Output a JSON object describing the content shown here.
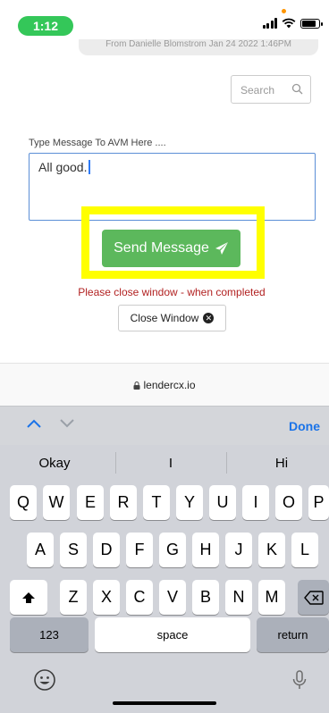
{
  "status": {
    "time": "1:12"
  },
  "chat": {
    "bubble_text": "From Danielle Blomstrom Jan 24 2022 1:46PM"
  },
  "search": {
    "placeholder": "Search"
  },
  "form": {
    "label": "Type Message To AVM Here ....",
    "message_value": "All good.",
    "send_label": "Send Message",
    "warning": "Please close window - when completed",
    "close_label": "Close Window"
  },
  "browser": {
    "url": "lendercx.io"
  },
  "accessory": {
    "done_label": "Done"
  },
  "keyboard": {
    "suggestions": [
      "Okay",
      "I",
      "Hi"
    ],
    "row1": [
      "Q",
      "W",
      "E",
      "R",
      "T",
      "Y",
      "U",
      "I",
      "O",
      "P"
    ],
    "row2": [
      "A",
      "S",
      "D",
      "F",
      "G",
      "H",
      "J",
      "K",
      "L"
    ],
    "row3": [
      "Z",
      "X",
      "C",
      "V",
      "B",
      "N",
      "M"
    ],
    "numbers_label": "123",
    "space_label": "space",
    "return_label": "return"
  },
  "colors": {
    "send_green": "#5cb85c",
    "highlight": "#ffff00",
    "warning_red": "#b22222",
    "link_blue": "#1a73e8"
  }
}
